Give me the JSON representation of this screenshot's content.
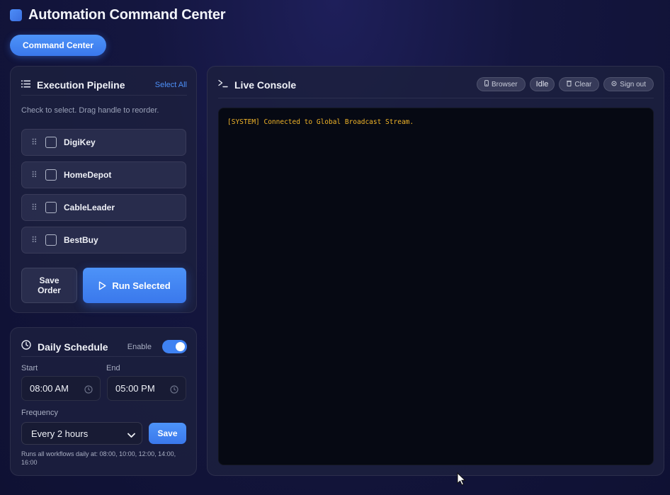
{
  "app": {
    "title": "Automation Command Center"
  },
  "nav": {
    "active_tab": "Command Center"
  },
  "pipeline": {
    "title": "Execution Pipeline",
    "select_all": "Select All",
    "hint": "Check to select. Drag handle to reorder.",
    "items": [
      {
        "name": "DigiKey",
        "checked": false
      },
      {
        "name": "HomeDepot",
        "checked": false
      },
      {
        "name": "CableLeader",
        "checked": false
      },
      {
        "name": "BestBuy",
        "checked": false
      }
    ],
    "save_order_label": "Save Order",
    "run_selected_label": "Run Selected"
  },
  "schedule": {
    "title": "Daily Schedule",
    "enable_label": "Enable",
    "enabled": true,
    "start_label": "Start",
    "start_value": "08:00 AM",
    "end_label": "End",
    "end_value": "05:00 PM",
    "frequency_label": "Frequency",
    "frequency_value": "Every 2 hours",
    "save_label": "Save",
    "note": "Runs all workflows daily at: 08:00, 10:00, 12:00, 14:00, 16:00"
  },
  "console": {
    "title": "Live Console",
    "browser_label": "Browser",
    "status": "Idle",
    "clear_label": "Clear",
    "signout_label": "Sign out",
    "lines": [
      "[SYSTEM] Connected to Global Broadcast Stream."
    ]
  },
  "colors": {
    "accent": "#3f82f2",
    "log_text": "#f0b429",
    "background": "#14163f"
  }
}
